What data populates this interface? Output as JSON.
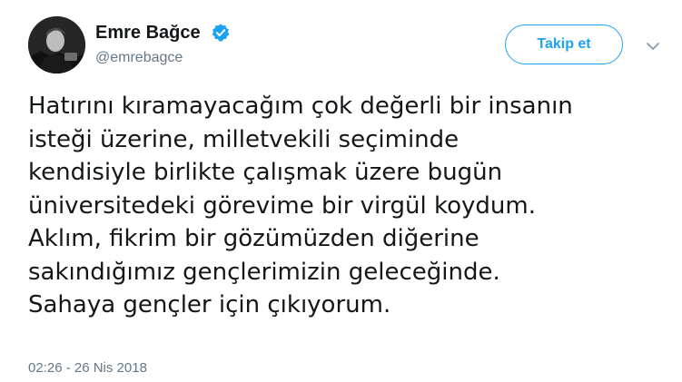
{
  "author": {
    "name": "Emre Bağce",
    "handle": "@emrebagce",
    "verified": true
  },
  "actions": {
    "follow_label": "Takip et"
  },
  "tweet": {
    "lines": [
      "Hatırını kıramayacağım çok değerli bir insanın",
      "isteği üzerine, milletvekili seçiminde",
      "kendisiyle birlikte çalışmak üzere bugün",
      "üniversitedeki görevime bir virgül koydum.",
      "Aklım, fikrim bir gözümüzden diğerine",
      "sakındığımız gençlerimizin geleceğinde.",
      "Sahaya gençler için çıkıyorum."
    ],
    "timestamp": "02:26 - 26 Nis 2018"
  },
  "colors": {
    "accent": "#1da1f2",
    "text_primary": "#14171a",
    "text_secondary": "#657786"
  },
  "icons": {
    "verified": "verified-badge-icon",
    "caret": "chevron-down-icon"
  }
}
